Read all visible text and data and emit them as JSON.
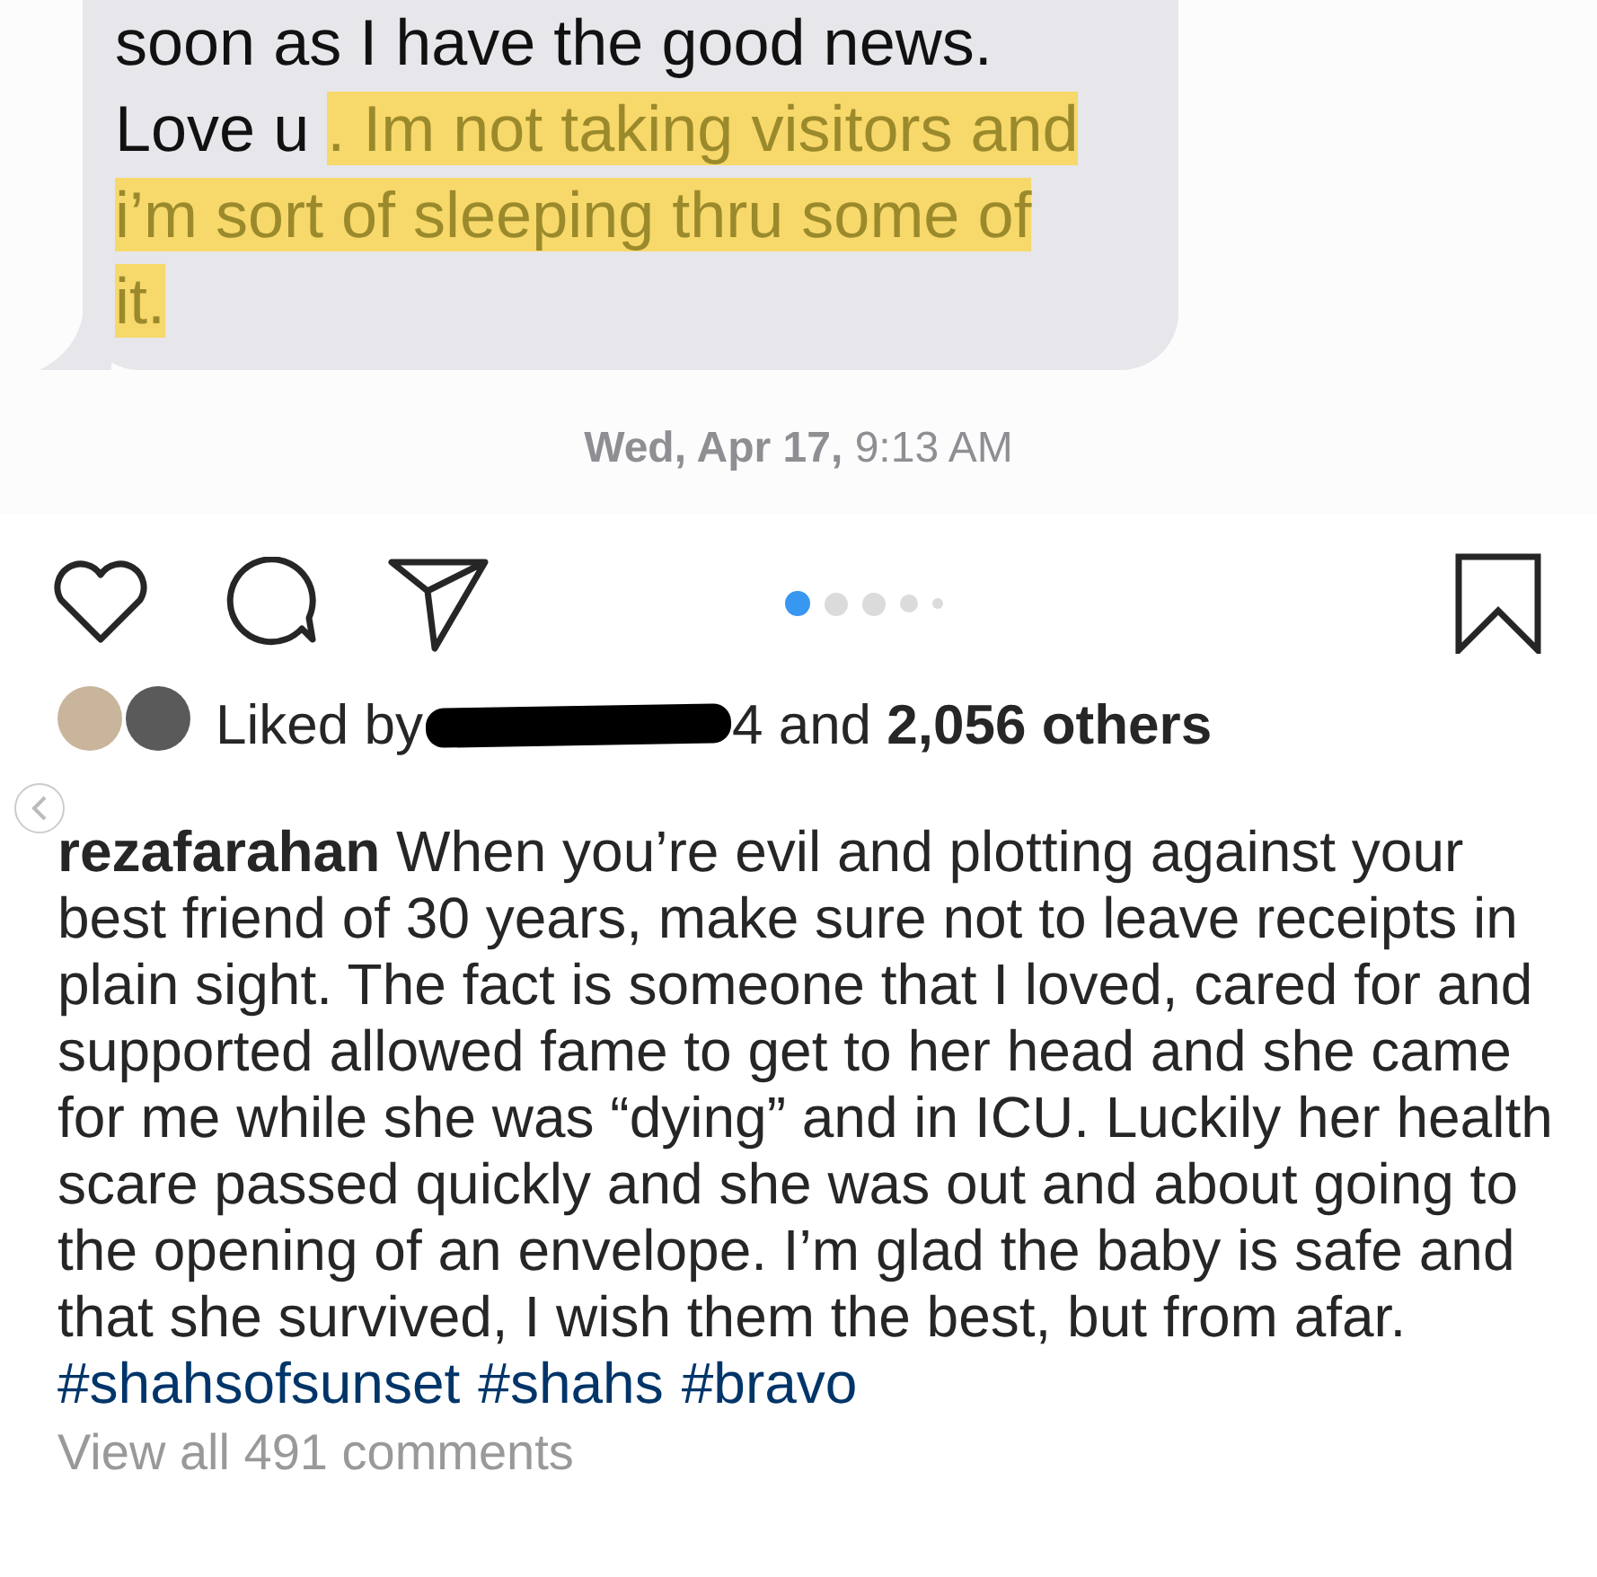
{
  "message": {
    "text": "soon as I have the good news. Love u ",
    "highlighted": ". Im not taking visitors and i’m sort of sleeping thru some of it."
  },
  "timestamp": "**Wed, Apr 17,** 9:13 AM",
  "carousel_dots": [
    {
      "selected": true
    },
    {
      "selected": false
    },
    {
      "selected": false
    },
    {
      "selected": false
    },
    {
      "selected": false
    }
  ],
  "likes": {
    "prefix": "Liked by",
    "suffix": "4 and **2,056 others**"
  },
  "caption": "**rezafarahan** When you’re evil and plotting against your best friend of 30 years, make sure not to leave receipts in plain sight. The fact is someone that I loved, cared for and supported allowed fame to get to her head and she came for me while she was “dying” and in ICU. Luckily her health scare passed quickly and she was out and about going to the opening of an envelope. I’m glad the baby is safe and that she survived, I wish them the best, but from afar.",
  "hashtags": [
    "#shahsofsunset",
    "#shahs",
    "#bravo"
  ],
  "comments_link": "View all 491 comments"
}
